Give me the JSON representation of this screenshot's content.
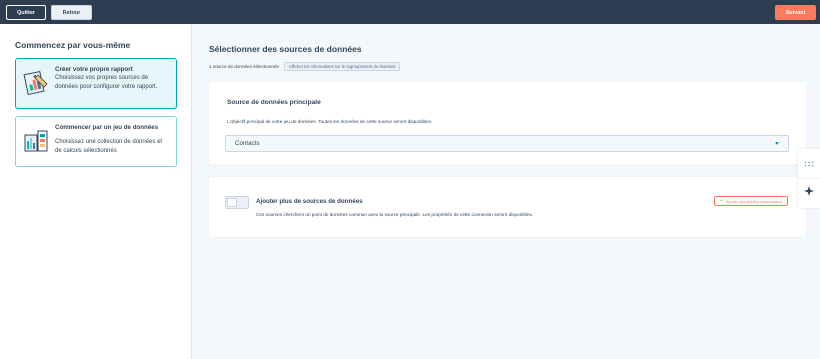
{
  "topbar": {
    "quit_label": "Quitter",
    "back_label": "Retour",
    "next_label": "Suivant"
  },
  "sidebar": {
    "title": "Commencez par vous-même",
    "cards": [
      {
        "title": "Créer votre propre rapport",
        "description": "Choisissez vos propres sources de données pour configurer votre rapport.",
        "selected": true,
        "icon": "report-builder-icon"
      },
      {
        "title": "Commencer par un jeu de données",
        "description": "Choisissez une collection de données et de calculs sélectionnés",
        "selected": false,
        "icon": "dataset-icon"
      }
    ]
  },
  "main": {
    "title": "Sélectionner des sources de données",
    "selected_count": "1 source de données sélectionnée",
    "info_chip": "Afficher les informations sur le regroupement de données",
    "primary": {
      "title": "Source de données principale",
      "description": "L'objectif principal de votre jeu de données. Toutes les données de cette source seront disponibles.",
      "select_value": "Contacts"
    },
    "more": {
      "title": "Ajouter plus de sources de données",
      "description": "Ces sources cherchent un point de données commun avec la source principale. Les propriétés de cette connexion seront disponibles.",
      "assoc_button": "Ajouter des libellés d'association",
      "toggle_on": false
    }
  },
  "colors": {
    "topbar": "#2d3e50",
    "accent": "#ff7a59",
    "teal": "#00a4bd",
    "selected_card_bg": "#e5f5f8"
  },
  "side_tools": [
    "grid-icon",
    "sparkle-icon"
  ]
}
